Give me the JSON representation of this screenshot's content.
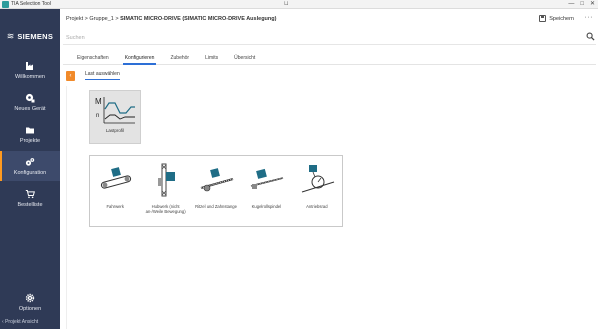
{
  "window": {
    "title": "TIA Selection Tool",
    "controls": [
      "—",
      "□",
      "✕"
    ]
  },
  "sidebar": {
    "brand": "SIEMENS",
    "items": [
      {
        "label": "Willkommen",
        "icon": "factory-icon"
      },
      {
        "label": "Neues Gerät",
        "icon": "new-device-icon"
      },
      {
        "label": "Projekte",
        "icon": "folder-icon"
      },
      {
        "label": "Konfiguration",
        "icon": "gears-icon",
        "active": true
      },
      {
        "label": "Bestelliste",
        "icon": "cart-icon"
      }
    ],
    "options_label": "Optionen",
    "project_view_label": "Projekt Ansicht"
  },
  "header": {
    "breadcrumb_prefix": "Projekt > Gruppe_1 > ",
    "breadcrumb_current": "SIMATIC MICRO-DRIVE (SIMATIC MICRO-DRIVE Auslegung)",
    "save_label": "Speichern",
    "more_label": "···"
  },
  "search": {
    "placeholder": "Suchen"
  },
  "tabs": [
    {
      "label": "Eigenschaften"
    },
    {
      "label": "Konfigurieren",
      "active": true
    },
    {
      "label": "Zubehör"
    },
    {
      "label": "Limits"
    },
    {
      "label": "Übersicht"
    }
  ],
  "actionbar": {
    "subtab_label": "Last auswählen"
  },
  "selected_card": {
    "label": "Lastprofil",
    "axis_letters": {
      "m": "M",
      "n": "n"
    }
  },
  "mechanisms": [
    {
      "label": "Fahrwerk",
      "icon": "conveyor-icon"
    },
    {
      "label": "Hubwerk (nicht an-/Weile Bewegung)",
      "icon": "hoist-icon"
    },
    {
      "label": "Ritzel und Zahnstange",
      "icon": "rack-pinion-icon"
    },
    {
      "label": "Kugelrollspindel",
      "icon": "ballscrew-icon"
    },
    {
      "label": "Antriebsrad",
      "icon": "drive-wheel-icon"
    }
  ],
  "colors": {
    "sidebar_bg": "#2f3a56",
    "accent_orange": "#f18a2a",
    "tab_underline": "#2d6fd6",
    "teal": "#1f6d86"
  }
}
